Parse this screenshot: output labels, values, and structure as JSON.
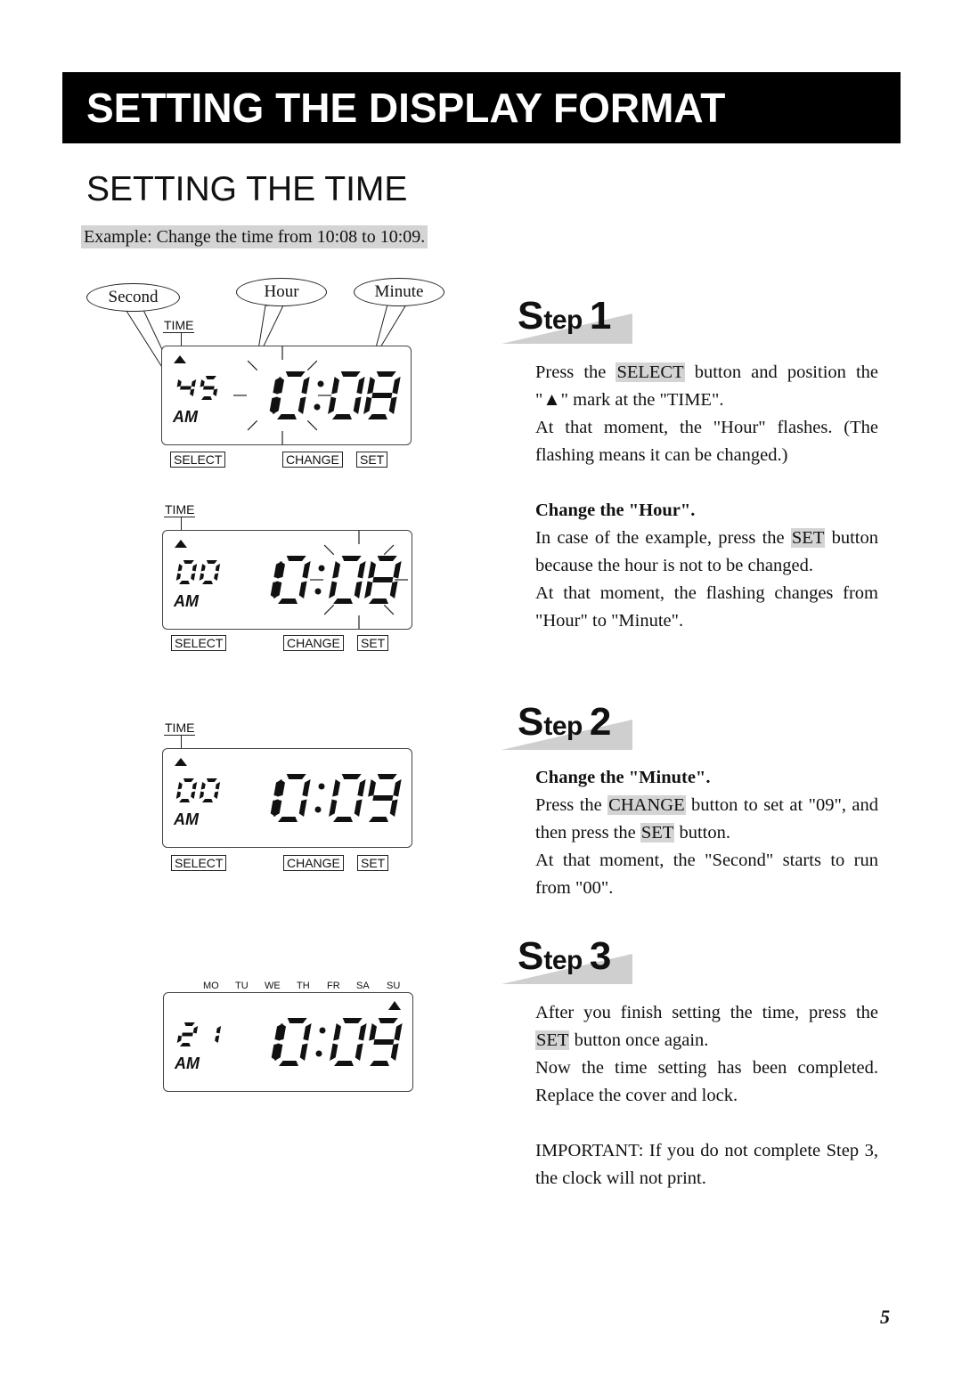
{
  "header": {
    "title": "SETTING THE DISPLAY FORMAT"
  },
  "section": {
    "title": "SETTING THE TIME",
    "example": "Example: Change the time from 10:08 to 10:09."
  },
  "callouts": {
    "second": "Second",
    "hour": "Hour",
    "minute": "Minute"
  },
  "icons": {
    "up_mark": "▲"
  },
  "displays": [
    {
      "label": "TIME",
      "seconds": "45",
      "ampm": "AM",
      "hours": "10",
      "minutes": "08",
      "flashing": "hour",
      "buttons": {
        "select": "SELECT",
        "change": "CHANGE",
        "set": "SET"
      }
    },
    {
      "label": "TIME",
      "seconds": "00",
      "ampm": "AM",
      "hours": "10",
      "minutes": "08",
      "flashing": "minute",
      "buttons": {
        "select": "SELECT",
        "change": "CHANGE",
        "set": "SET"
      }
    },
    {
      "label": "TIME",
      "seconds": "00",
      "ampm": "AM",
      "hours": "10",
      "minutes": "09",
      "flashing": "none",
      "buttons": {
        "select": "SELECT",
        "change": "CHANGE",
        "set": "SET"
      }
    },
    {
      "days": [
        "MO",
        "TU",
        "WE",
        "TH",
        "FR",
        "SA",
        "SU"
      ],
      "active_day": "SU",
      "seconds": "21",
      "ampm": "AM",
      "hours": "10",
      "minutes": "09",
      "flashing": "none"
    }
  ],
  "steps": [
    {
      "step_word": "Step",
      "number": "1",
      "intro": {
        "pre": "Press the ",
        "btn": "SELECT",
        "post": " button and position the \"▲\" mark at the \"TIME\"."
      },
      "intro2": "At that moment, the \"Hour\" flashes. (The flashing means it can be changed.)",
      "heading": "Change the \"Hour\".",
      "body": {
        "pre": "In case of the example, press the ",
        "btn": "SET",
        "post": " button because the hour is not to be changed."
      },
      "body2": "At that moment, the flashing changes from \"Hour\" to \"Minute\"."
    },
    {
      "step_word": "Step",
      "number": "2",
      "heading": "Change the \"Minute\".",
      "body": {
        "pre": "Press the ",
        "btn": "CHANGE",
        "mid": " button to set at \"09\", and then press the ",
        "btn2": "SET",
        "post": " button."
      },
      "body2": "At that moment, the \"Second\" starts to run from \"00\"."
    },
    {
      "step_word": "Step",
      "number": "3",
      "body": {
        "pre": "After you finish setting the time, press the ",
        "btn": "SET",
        "post": " button once again."
      },
      "body2": "Now the time setting has been completed. Replace the cover and lock.",
      "important": "IMPORTANT: If you do not complete Step 3, the clock will not print."
    }
  ],
  "page_number": "5"
}
